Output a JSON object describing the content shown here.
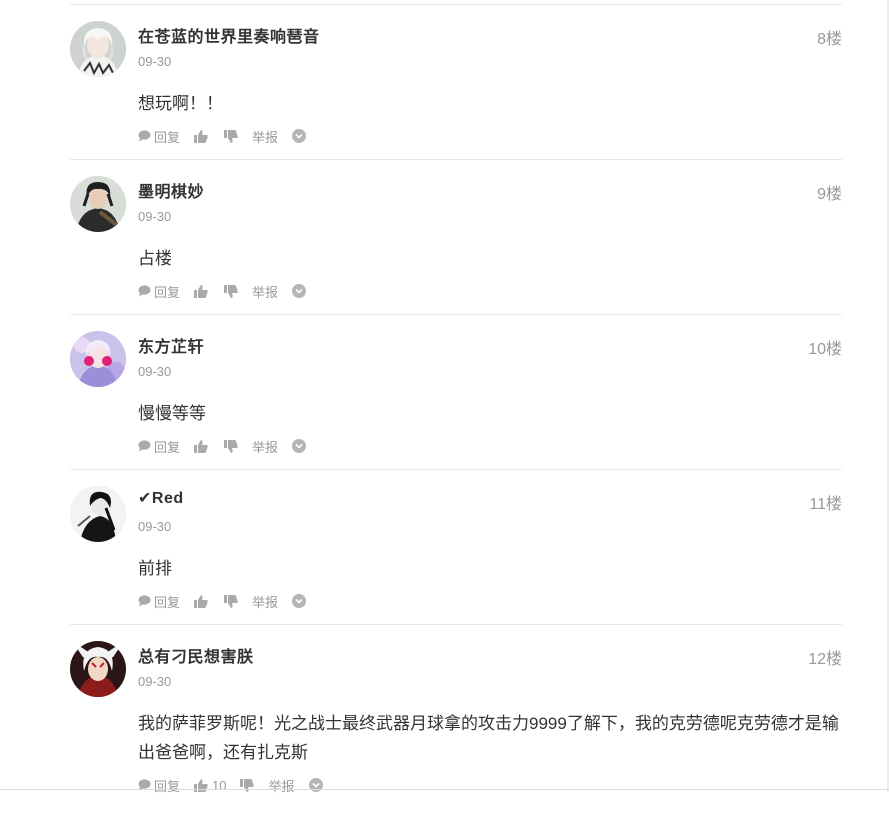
{
  "comments": [
    {
      "username": "在苍蓝的世界里奏响琶音",
      "date": "09-30",
      "floor": "8楼",
      "content": "想玩啊！！",
      "avatar": "avatar-white-hair",
      "likes": ""
    },
    {
      "username": "墨明棋妙",
      "date": "09-30",
      "floor": "9楼",
      "content": "占楼",
      "avatar": "avatar-dark-warrior",
      "likes": ""
    },
    {
      "username": "东方芷轩",
      "date": "09-30",
      "floor": "10楼",
      "content": "慢慢等等",
      "avatar": "avatar-pink-anime",
      "likes": ""
    },
    {
      "username": "✔Red",
      "date": "09-30",
      "floor": "11楼",
      "content": "前排",
      "avatar": "avatar-bw-sketch",
      "likes": ""
    },
    {
      "username": "总有刁民想害朕",
      "date": "09-30",
      "floor": "12楼",
      "content": "我的萨菲罗斯呢！光之战士最终武器月球拿的攻击力9999了解下，我的克劳德呢克劳德才是输出爸爸啊，还有扎克斯",
      "avatar": "avatar-red-white-hair",
      "likes": "10"
    }
  ],
  "actions": {
    "reply": "回复",
    "report": "举报"
  },
  "colors": {
    "muted": "#999999",
    "text": "#333333",
    "divider": "#e9e9e9",
    "icon": "#aaaaaa"
  }
}
